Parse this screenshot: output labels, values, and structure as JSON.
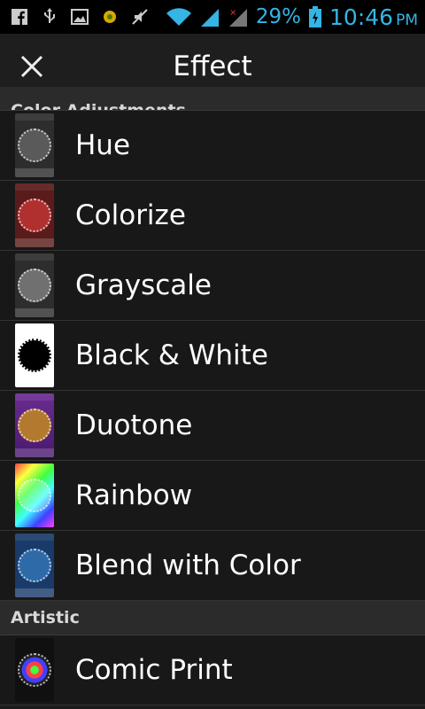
{
  "status": {
    "battery_percent": "29%",
    "time": "10:46",
    "ampm": "PM",
    "accent": "#34b5e5"
  },
  "appbar": {
    "title": "Effect",
    "close_icon": "close-icon"
  },
  "sections": [
    {
      "name": "Color Adjustments",
      "items": [
        {
          "label": "Hue",
          "thumb_bg": "#2d2d2d",
          "dial": "#5a5a5a"
        },
        {
          "label": "Colorize",
          "thumb_bg": "#5a1b1b",
          "dial": "#b03030"
        },
        {
          "label": "Grayscale",
          "thumb_bg": "#2d2d2d",
          "dial": "#707070"
        },
        {
          "label": "Black & White",
          "thumb_bg": "#ffffff",
          "dial": "#000000"
        },
        {
          "label": "Duotone",
          "thumb_bg": "#6a2c90",
          "dial": "#b37a2f"
        },
        {
          "label": "Rainbow",
          "thumb_bg": "#ff40a0",
          "dial": "#40ff80"
        },
        {
          "label": "Blend with Color",
          "thumb_bg": "#1a3a6a",
          "dial": "#2f6aa8"
        }
      ]
    },
    {
      "name": "Artistic",
      "items": [
        {
          "label": "Comic Print",
          "thumb_bg": "#101010",
          "dial": "#3a7a3a"
        }
      ]
    }
  ]
}
